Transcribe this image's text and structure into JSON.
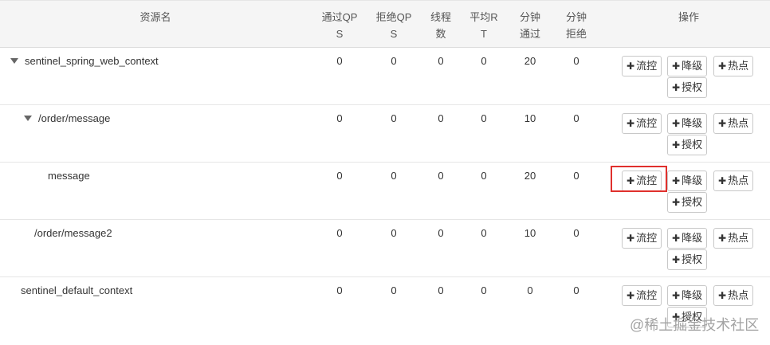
{
  "columns": {
    "resource": "资源名",
    "pass_qps_1": "通过QP",
    "pass_qps_2": "S",
    "block_qps_1": "拒绝QP",
    "block_qps_2": "S",
    "threads_1": "线程",
    "threads_2": "数",
    "avg_rt_1": "平均R",
    "avg_rt_2": "T",
    "min_pass_1": "分钟",
    "min_pass_2": "通过",
    "min_block_1": "分钟",
    "min_block_2": "拒绝",
    "ops": "操作"
  },
  "actions": {
    "flow": "流控",
    "degrade": "降级",
    "hotspot": "热点",
    "auth": "授权"
  },
  "rows": [
    {
      "name": "sentinel_spring_web_context",
      "expanded": true,
      "pass_qps": "0",
      "block_qps": "0",
      "threads": "0",
      "avg_rt": "0",
      "min_pass": "20",
      "min_block": "0"
    },
    {
      "name": "/order/message",
      "expanded": true,
      "pass_qps": "0",
      "block_qps": "0",
      "threads": "0",
      "avg_rt": "0",
      "min_pass": "10",
      "min_block": "0"
    },
    {
      "name": "message",
      "pass_qps": "0",
      "block_qps": "0",
      "threads": "0",
      "avg_rt": "0",
      "min_pass": "20",
      "min_block": "0"
    },
    {
      "name": "/order/message2",
      "pass_qps": "0",
      "block_qps": "0",
      "threads": "0",
      "avg_rt": "0",
      "min_pass": "10",
      "min_block": "0"
    },
    {
      "name": "sentinel_default_context",
      "pass_qps": "0",
      "block_qps": "0",
      "threads": "0",
      "avg_rt": "0",
      "min_pass": "0",
      "min_block": "0"
    }
  ],
  "watermark": "@稀土掘金技术社区",
  "colors": {
    "highlight": "#e0302d",
    "header_bg": "#f5f5f5"
  }
}
